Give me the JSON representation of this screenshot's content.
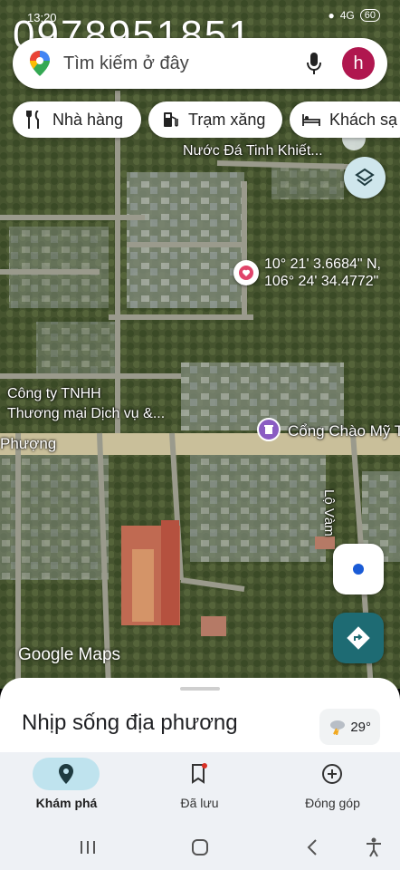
{
  "status": {
    "time": "13:20",
    "signal": "4G",
    "battery": "60"
  },
  "watermark": "0978951851",
  "search": {
    "placeholder": "Tìm kiếm ở đây",
    "avatar_letter": "h"
  },
  "chips": [
    {
      "label": "Nhà hàng",
      "icon": "fork-knife-icon"
    },
    {
      "label": "Trạm xăng",
      "icon": "gas-station-icon"
    },
    {
      "label": "Khách sạ",
      "icon": "bed-icon"
    }
  ],
  "map": {
    "labels": {
      "ice_factory": "Nước Đá Tinh Khiết...",
      "company_line1": "Công ty TNHH",
      "company_line2": "Thương mại Dịch vụ &...",
      "gate": "Cổng Chào Mỹ T",
      "road_left": "Phượng",
      "road_right": "Lộ Vàm"
    },
    "coordinates": {
      "lat": "10° 21' 3.6684\" N,",
      "lng": "106° 24' 34.4772\""
    },
    "logo": "Google Maps"
  },
  "sheet": {
    "title": "Nhịp sống địa phương",
    "weather": "29°"
  },
  "nav": [
    {
      "label": "Khám phá",
      "icon": "location-pin-icon",
      "active": true
    },
    {
      "label": "Đã lưu",
      "icon": "bookmark-icon",
      "active": false
    },
    {
      "label": "Đóng góp",
      "icon": "add-circle-icon",
      "active": false
    }
  ],
  "colors": {
    "accent": "#1e6b73",
    "avatar": "#b0174f",
    "pin_heart": "#e0446a",
    "pin_gate": "#8a5cc2",
    "nav_active": "#bfe3ee"
  }
}
